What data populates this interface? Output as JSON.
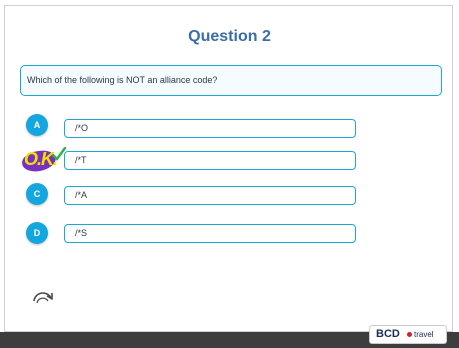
{
  "slide": {
    "title": "Question 2",
    "question": "Which of the following is NOT an alliance code?"
  },
  "options": [
    {
      "letter": "A",
      "text": "/*O"
    },
    {
      "letter": "B",
      "text": "/*T",
      "marked": "O.K."
    },
    {
      "letter": "C",
      "text": "/*A"
    },
    {
      "letter": "D",
      "text": "/*S"
    }
  ],
  "ok_mark": "O.K.",
  "logo": {
    "brand": "BCD",
    "suffix": "travel"
  },
  "icons": {
    "replay": "replay-icon",
    "ok": "ok-stamp-icon"
  },
  "colors": {
    "accent": "#14a6df",
    "title": "#3a6ea9",
    "ok_purple": "#7b2fbf",
    "ok_yellow": "#f2e200",
    "footer": "#3d3d3d"
  }
}
